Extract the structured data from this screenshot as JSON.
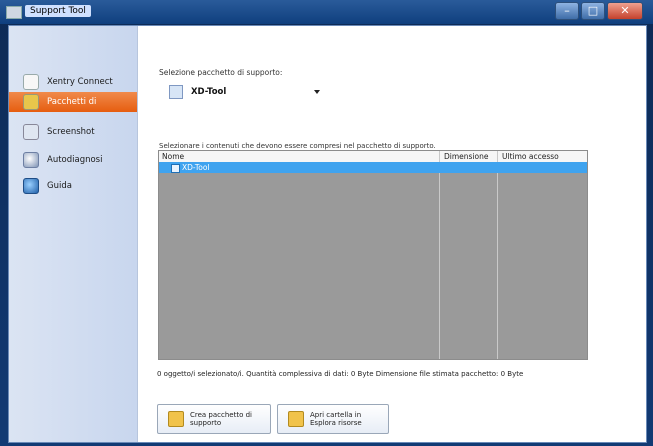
{
  "window": {
    "title": "Support Tool"
  },
  "sidebar": {
    "items": [
      {
        "label": "Xentry Connect",
        "icon": "info-icon",
        "active": false
      },
      {
        "label": "Pacchetti di",
        "icon": "package-icon",
        "active": true
      },
      {
        "label": "Screenshot",
        "icon": "screenshot-icon",
        "active": false
      },
      {
        "label": "Autodiagnosi",
        "icon": "diagnostic-icon",
        "active": false
      },
      {
        "label": "Guida",
        "icon": "help-icon",
        "active": false
      }
    ]
  },
  "main": {
    "package_label": "Selezione pacchetto di supporto:",
    "package_selected": "XD-Tool",
    "contents_label": "Selezionare i contenuti che devono essere compresi nel pacchetto di supporto.",
    "list": {
      "columns": [
        "Nome",
        "Dimensione",
        "Ultimo accesso"
      ],
      "rows": [
        {
          "name": "XD-Tool",
          "size": "",
          "last": "",
          "selected": true,
          "checked": true
        }
      ]
    },
    "status": "0 oggetto/i selezionato/i.  Quantità complessiva di dati: 0 Byte  Dimensione file stimata pacchetto: 0 Byte",
    "buttons": {
      "create": "Crea pacchetto di supporto",
      "open_folder": "Apri cartella in Esplora risorse"
    }
  },
  "colors": {
    "active_nav": "#e65d0f",
    "list_selection": "#3fa3ef",
    "list_background": "#9a9a9a"
  }
}
